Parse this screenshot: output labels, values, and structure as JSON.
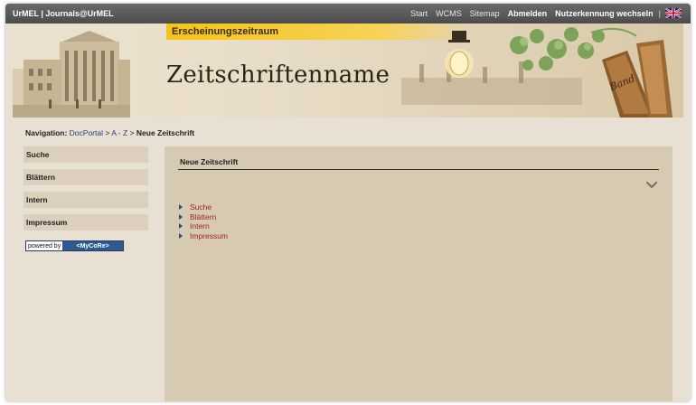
{
  "topbar": {
    "brand": "UrMEL | Journals@UrMEL",
    "nav": {
      "start": "Start",
      "wcms": "WCMS",
      "sitemap": "Sitemap",
      "logout": "Abmelden",
      "switch_user": "Nutzerkennung wechseln",
      "separator": "|"
    }
  },
  "header": {
    "era_label": "Erscheinungszeitraum",
    "journal_title": "Zeitschriftenname"
  },
  "breadcrumb": {
    "label": "Navigation:",
    "items": [
      "DocPortal",
      "A - Z"
    ],
    "separator": ">",
    "current": "Neue Zeitschrift"
  },
  "sidebar": {
    "items": [
      "Suche",
      "Blättern",
      "Intern",
      "Impressum"
    ]
  },
  "powered_by": {
    "prefix": "powered by",
    "name": "<MyCoRe>"
  },
  "main": {
    "title": "Neue Zeitschrift",
    "links": [
      "Suche",
      "Blättern",
      "Intern",
      "Impressum"
    ]
  },
  "colors": {
    "accent_yellow": "#f4c419",
    "link_red": "#a02323",
    "nav_blue": "#2a3d7a",
    "panel": "#d6cab3"
  },
  "icons": [
    "flag-en-icon",
    "chevron-down-icon",
    "bullet-triangle-icon"
  ]
}
